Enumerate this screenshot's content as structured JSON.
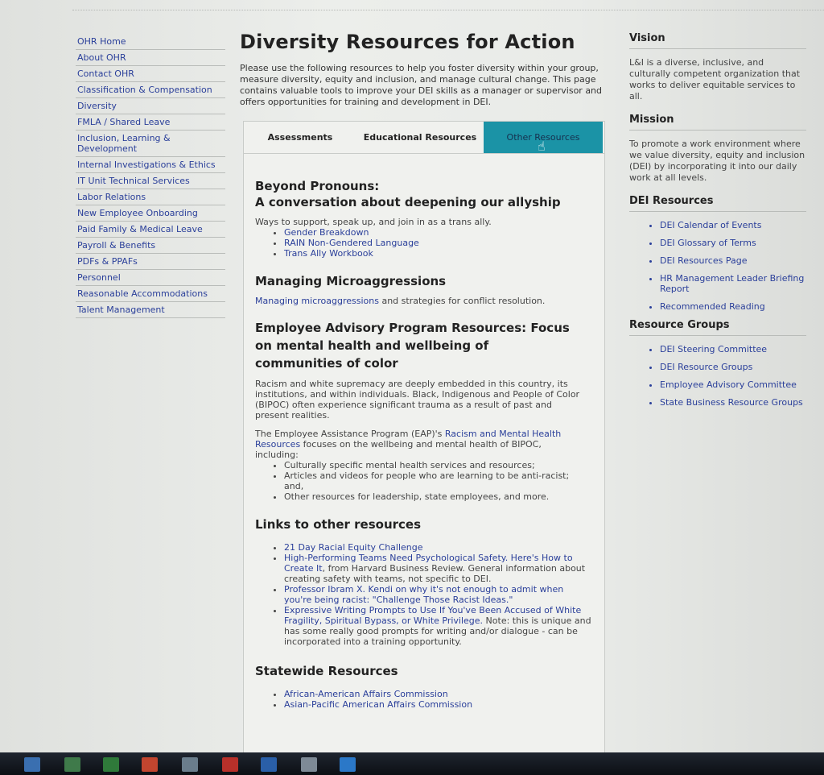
{
  "leftnav": {
    "items": [
      "OHR Home",
      "About OHR",
      "Contact OHR",
      "Classification & Compensation",
      "Diversity",
      "FMLA / Shared Leave",
      "Inclusion, Learning & Development",
      "Internal Investigations & Ethics",
      "IT Unit Technical Services",
      "Labor Relations",
      "New Employee Onboarding",
      "Paid Family & Medical Leave",
      "Payroll & Benefits",
      "PDFs & PPAFs",
      "Personnel",
      "Reasonable Accommodations",
      "Talent Management"
    ]
  },
  "main": {
    "title": "Diversity Resources for Action",
    "intro": "Please use the following resources to help you foster diversity within your group, measure diversity, equity and inclusion, and manage cultural change. This page contains valuable tools to improve your DEI skills as a manager or supervisor and offers opportunities for training and development in DEI.",
    "tabs": [
      {
        "label": "Assessments",
        "active": false
      },
      {
        "label": "Educational Resources",
        "active": false
      },
      {
        "label": "Other Resources",
        "active": true
      }
    ],
    "sections": {
      "pronouns": {
        "heading1": "Beyond Pronouns:",
        "heading2": "A conversation about deepening our allyship",
        "text": "Ways to support, speak up, and join in as a trans ally.",
        "links": [
          "Gender Breakdown",
          "RAIN Non-Gendered Language",
          "Trans Ally Workbook"
        ]
      },
      "micro": {
        "heading": "Managing Microaggressions",
        "link": "Managing microaggressions",
        "text": " and strategies for conflict resolution."
      },
      "eap": {
        "heading": "Employee Advisory Program Resources: Focus on mental health and wellbeing of communities of color",
        "para1": "Racism and white supremacy are deeply embedded in this country, its institutions, and within individuals. Black, Indigenous and People of Color (BIPOC) often experience significant trauma as a result of past and present realities.",
        "para2_pre": "The Employee Assistance Program (EAP)'s ",
        "para2_link": "Racism and Mental Health Resources",
        "para2_post": " focuses on the wellbeing and mental health of BIPOC, including:",
        "bullets": [
          "Culturally specific mental health services and resources;",
          "Articles and videos for people who are learning to be anti-racist; and,",
          "Other resources for leadership, state employees, and more."
        ]
      },
      "links": {
        "heading": "Links to other resources",
        "item1": "21 Day Racial Equity Challenge",
        "item2_link": "High-Performing Teams Need Psychological Safety. Here's How to Create It",
        "item2_text": ", from Harvard Business Review. General information about creating safety with teams, not specific to DEI.",
        "item3_link": "Professor Ibram X. Kendi on why it's not enough to admit when you're being racist: \"Challenge Those Racist Ideas.\"",
        "item4_link": "Expressive Writing Prompts to Use If You've Been Accused of White Fragility, Spiritual Bypass, or White Privilege.",
        "item4_text": " Note: this is unique and has some really good prompts for writing and/or dialogue - can be incorporated into a training opportunity."
      },
      "statewide": {
        "heading": "Statewide Resources",
        "links": [
          "African-American Affairs Commission",
          "Asian-Pacific American Affairs Commission"
        ]
      }
    }
  },
  "right": {
    "vision_title": "Vision",
    "vision_text": "L&I is a diverse, inclusive, and culturally competent organization that works to deliver equitable services to all.",
    "mission_title": "Mission",
    "mission_text": "To promote a work environment where we value diversity, equity and inclusion (DEI) by incorporating it into our daily work at all levels.",
    "dei_title": "DEI Resources",
    "dei_links": [
      "DEI Calendar of Events",
      "DEI Glossary of Terms",
      "DEI Resources Page",
      "HR Management Leader Briefing Report",
      "Recommended Reading"
    ],
    "groups_title": "Resource Groups",
    "group_links": [
      "DEI Steering Committee",
      "DEI Resource Groups",
      "Employee Advisory Committee",
      "State Business Resource Groups"
    ]
  },
  "colors": {
    "active_tab": "#1b93a6",
    "link": "#2a3f9a"
  }
}
